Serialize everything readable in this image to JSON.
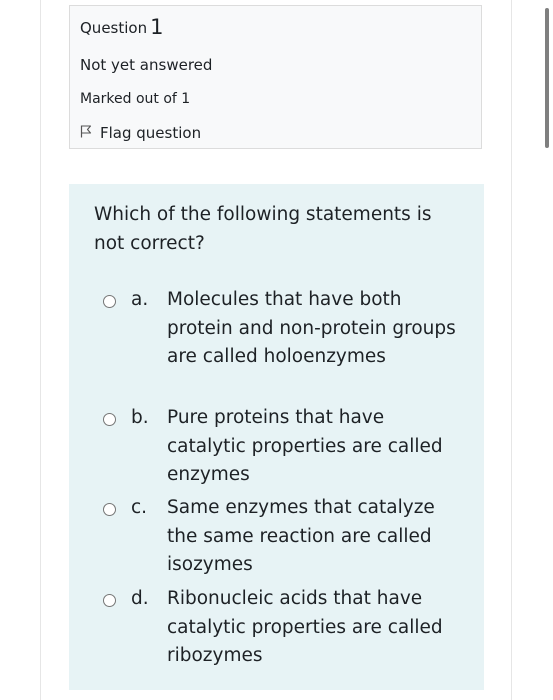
{
  "info": {
    "question_label": "Question",
    "question_number": "1",
    "state": "Not yet answered",
    "grade": "Marked out of 1",
    "flag_label": "Flag question"
  },
  "question": {
    "text": "Which of the following statements is not correct?",
    "answers": [
      {
        "letter": "a.",
        "text": "Molecules that have both protein and non-protein groups are called holoenzymes",
        "selected": false
      },
      {
        "letter": "b.",
        "text": "Pure proteins that have catalytic properties are called enzymes",
        "selected": false
      },
      {
        "letter": "c.",
        "text": "Same enzymes that catalyze the same reaction are called isozymes",
        "selected": false
      },
      {
        "letter": "d.",
        "text": "Ribonucleic acids that have catalytic properties are called ribozymes",
        "selected": false
      }
    ]
  },
  "colors": {
    "info_bg": "#f8f9fa",
    "content_bg": "#e7f3f5",
    "text": "#1d2125"
  }
}
